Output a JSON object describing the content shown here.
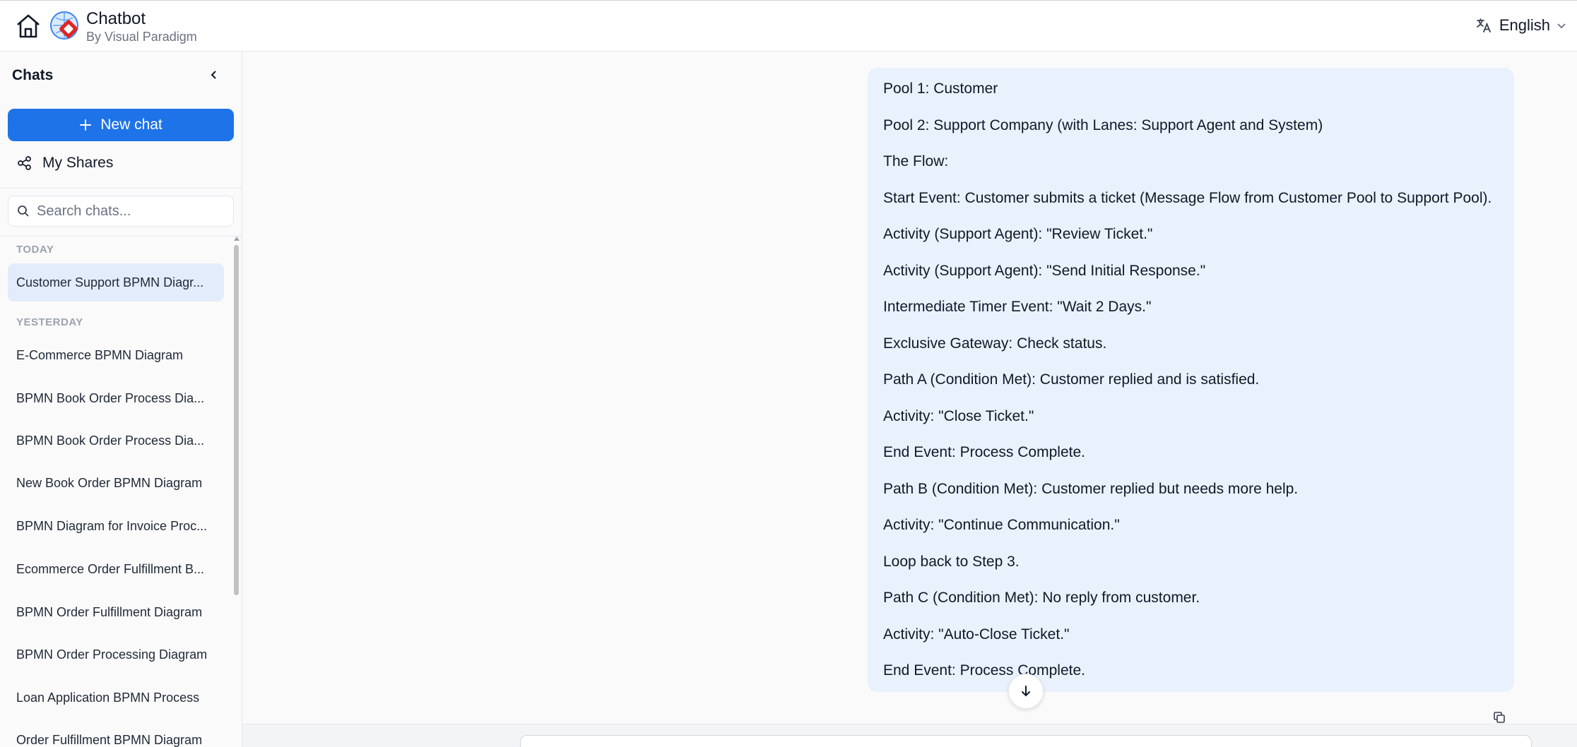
{
  "header": {
    "title": "Chatbot",
    "subtitle": "By Visual Paradigm",
    "language": "English"
  },
  "sidebar": {
    "heading": "Chats",
    "new_chat_label": "New chat",
    "my_shares_label": "My Shares",
    "search_placeholder": "Search chats...",
    "groups": [
      {
        "label": "TODAY",
        "items": [
          {
            "title": "Customer Support BPMN Diagr...",
            "active": true
          }
        ]
      },
      {
        "label": "YESTERDAY",
        "items": [
          {
            "title": "E-Commerce BPMN Diagram"
          },
          {
            "title": "BPMN Book Order Process Dia..."
          },
          {
            "title": "BPMN Book Order Process Dia..."
          },
          {
            "title": "New Book Order BPMN Diagram"
          },
          {
            "title": "BPMN Diagram for Invoice Proc..."
          },
          {
            "title": "Ecommerce Order Fulfillment B..."
          },
          {
            "title": "BPMN Order Fulfillment Diagram"
          },
          {
            "title": "BPMN Order Processing Diagram"
          },
          {
            "title": "Loan Application BPMN Process"
          },
          {
            "title": "Order Fulfillment BPMN Diagram"
          }
        ]
      }
    ]
  },
  "message": {
    "lines": [
      "Pool 1: Customer",
      "Pool 2: Support Company (with Lanes: Support Agent and System)",
      "The Flow:",
      "Start Event: Customer submits a ticket (Message Flow from Customer Pool to Support Pool).",
      "Activity (Support Agent): \"Review Ticket.\"",
      "Activity (Support Agent): \"Send Initial Response.\"",
      "Intermediate Timer Event: \"Wait 2 Days.\"",
      "Exclusive Gateway: Check status.",
      "Path A (Condition Met): Customer replied and is satisfied.",
      "Activity: \"Close Ticket.\"",
      "End Event: Process Complete.",
      "Path B (Condition Met): Customer replied but needs more help.",
      "Activity: \"Continue Communication.\"",
      "Loop back to Step 3.",
      "Path C (Condition Met): No reply from customer.",
      "Activity: \"Auto-Close Ticket.\"",
      "End Event: Process Complete."
    ]
  },
  "colors": {
    "accent": "#1f73e8",
    "bubble": "#e9f1fd",
    "active_item": "#e3ecfb"
  }
}
